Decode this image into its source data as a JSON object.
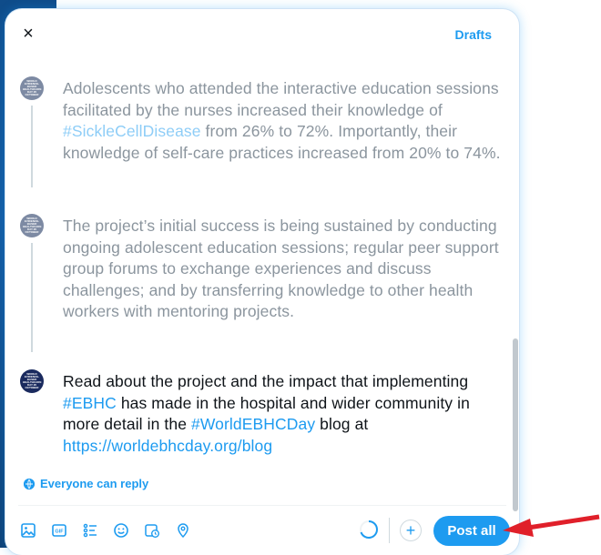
{
  "header": {
    "close_label": "×",
    "drafts_label": "Drafts"
  },
  "posts": [
    {
      "avatar_text": "WORLD EVIDENCE-BASED HEALTHCARE DAY 20 OCTOBER",
      "segments": [
        "Adolescents who attended the interactive education sessions facilitated by the nurses increased their knowledge of ",
        "#SickleCellDisease",
        " from 26% to 72%. Importantly, their knowledge of self-care practices increased from 20% to 74%."
      ]
    },
    {
      "avatar_text": "WORLD EVIDENCE-BASED HEALTHCARE DAY 20 OCTOBER",
      "segments": [
        "The project’s initial success is being sustained by conducting ongoing adolescent education sessions; regular peer support group forums to exchange experiences and discuss challenges; and by transferring knowledge to other health workers with mentoring projects."
      ]
    },
    {
      "avatar_text": "WORLD EVIDENCE-BASED HEALTHCARE DAY 20 OCTOBER",
      "segments": [
        "Read about the project and the impact that implementing ",
        "#EBHC",
        " has made in the hospital and wider community in more detail in the ",
        "#WorldEBHCDay",
        " blog at ",
        "https://worldebhcday.org/blog"
      ]
    }
  ],
  "reply_setting": {
    "icon": "globe-icon",
    "label": "Everyone can reply"
  },
  "toolbar": {
    "tools": [
      "image-icon",
      "gif-icon",
      "poll-icon",
      "emoji-icon",
      "schedule-icon",
      "location-icon"
    ],
    "add_label": "+",
    "post_all_label": "Post all"
  },
  "colors": {
    "accent": "#1d9bf0",
    "arrow": "#e0202a"
  }
}
